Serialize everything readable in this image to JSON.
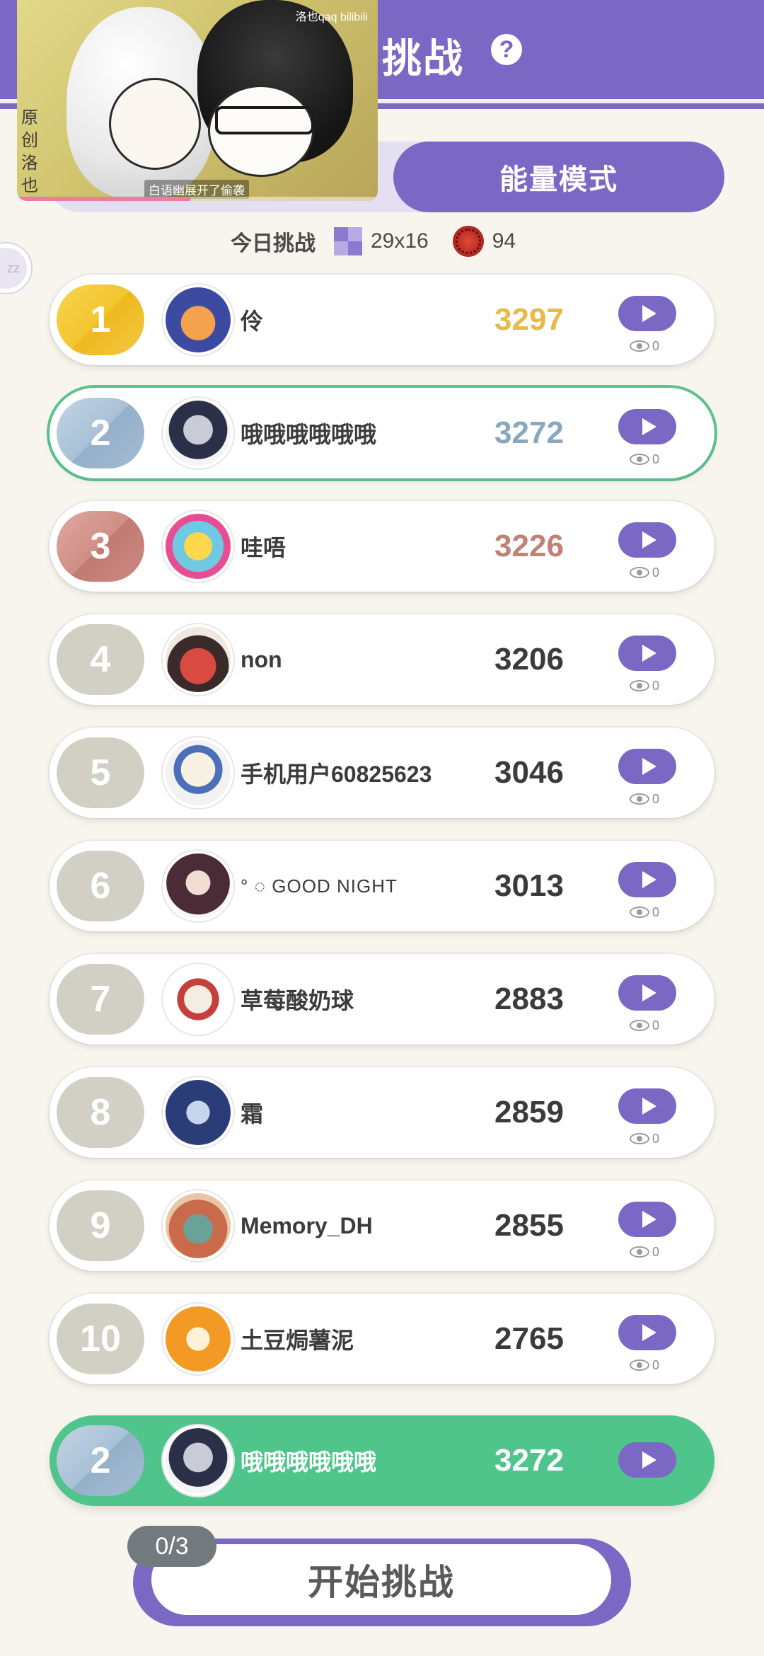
{
  "header": {
    "title": "挑战",
    "help_glyph": "?"
  },
  "video": {
    "side_text": "原创洛也",
    "watermark": "洛也qaq bilibili",
    "subtitle": "白语幽展开了偷袭"
  },
  "mode": {
    "active_label": "能量模式"
  },
  "side_bubble": {
    "text": "zz"
  },
  "today": {
    "label": "今日挑战",
    "board_size": "29x16",
    "mines": "94"
  },
  "rows": [
    {
      "rank": "1",
      "name": "伶",
      "score": "3297",
      "views": "0"
    },
    {
      "rank": "2",
      "name": "哦哦哦哦哦哦",
      "score": "3272",
      "views": "0"
    },
    {
      "rank": "3",
      "name": "哇唔",
      "score": "3226",
      "views": "0"
    },
    {
      "rank": "4",
      "name": "non",
      "score": "3206",
      "views": "0"
    },
    {
      "rank": "5",
      "name": "手机用户60825623",
      "score": "3046",
      "views": "0"
    },
    {
      "rank": "6",
      "name": "° ◌ GOOD NIGHT",
      "score": "3013",
      "views": "0"
    },
    {
      "rank": "7",
      "name": "草莓酸奶球",
      "score": "2883",
      "views": "0"
    },
    {
      "rank": "8",
      "name": "霜",
      "score": "2859",
      "views": "0"
    },
    {
      "rank": "9",
      "name": "Memory_DH",
      "score": "2855",
      "views": "0"
    },
    {
      "rank": "10",
      "name": "土豆焗薯泥",
      "score": "2765",
      "views": "0"
    }
  ],
  "me": {
    "rank": "2",
    "name": "哦哦哦哦哦哦",
    "score": "3272"
  },
  "start": {
    "counter": "0/3",
    "label": "开始挑战"
  },
  "colors": {
    "accent": "#7b68c4",
    "highlight": "#4fc48b",
    "gold": "#e9b94a",
    "silver": "#8aa7c0",
    "bronze": "#bf8275"
  }
}
